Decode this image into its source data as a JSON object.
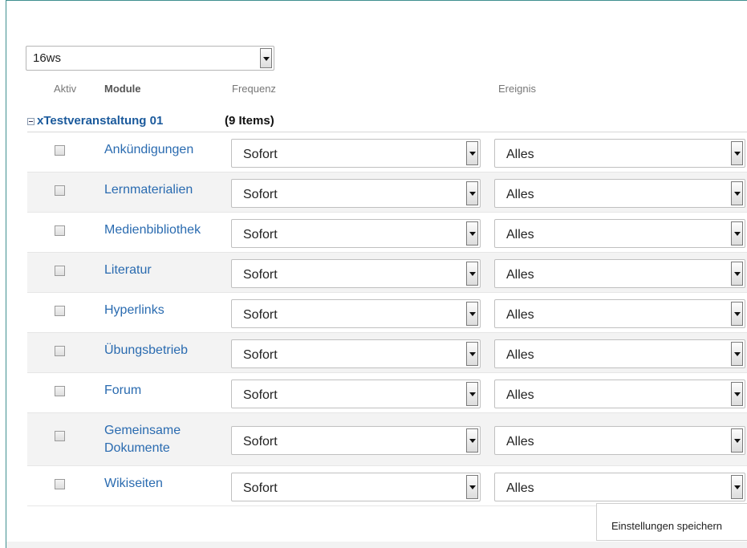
{
  "semester_select": {
    "value": "16ws"
  },
  "headers": {
    "aktiv": "Aktiv",
    "module": "Module",
    "frequenz": "Frequenz",
    "ereignis": "Ereignis"
  },
  "group": {
    "title": "xTestveranstaltung 01",
    "count": "(9 Items)"
  },
  "rows": [
    {
      "label": "Ankündigungen",
      "frequenz": "Sofort",
      "ereignis": "Alles"
    },
    {
      "label": "Lernmaterialien",
      "frequenz": "Sofort",
      "ereignis": "Alles"
    },
    {
      "label": "Medienbibliothek",
      "frequenz": "Sofort",
      "ereignis": "Alles"
    },
    {
      "label": "Literatur",
      "frequenz": "Sofort",
      "ereignis": "Alles"
    },
    {
      "label": "Hyperlinks",
      "frequenz": "Sofort",
      "ereignis": "Alles"
    },
    {
      "label": "Übungsbetrieb",
      "frequenz": "Sofort",
      "ereignis": "Alles"
    },
    {
      "label": "Forum",
      "frequenz": "Sofort",
      "ereignis": "Alles"
    },
    {
      "label": "Gemeinsame Dokumente",
      "frequenz": "Sofort",
      "ereignis": "Alles"
    },
    {
      "label": "Wikiseiten",
      "frequenz": "Sofort",
      "ereignis": "Alles"
    }
  ],
  "save_label": "Einstellungen speichern"
}
